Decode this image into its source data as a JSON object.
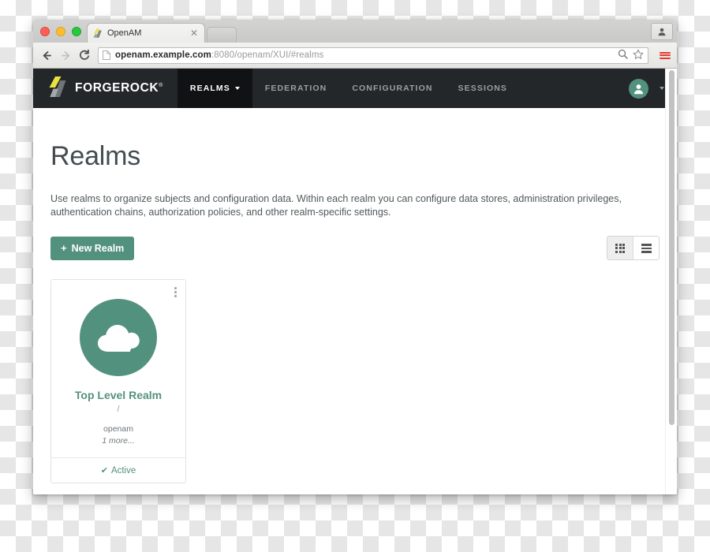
{
  "browser": {
    "tab": {
      "title": "OpenAM",
      "favicon_icon": "forgerock-favicon",
      "close_icon": "close-icon"
    },
    "new_tab_icon": "new-tab-button",
    "traffic_lights": [
      "close-window",
      "minimize-window",
      "maximize-window"
    ],
    "back_icon": "back-arrow-icon",
    "forward_icon": "forward-arrow-icon",
    "reload_icon": "reload-icon",
    "page_icon": "page-document-icon",
    "url_host": "openam.example.com",
    "url_rest": ":8080/openam/XUI/#realms",
    "search_icon": "search-icon",
    "bookmark_icon": "star-icon",
    "menu_icon": "hamburger-menu-icon",
    "profile_icon": "person-icon"
  },
  "appnav": {
    "brand": "FORGEROCK",
    "brand_trademark": "®",
    "brand_logo_icon": "forgerock-logo-icon",
    "items": [
      {
        "label": "REALMS",
        "active": true,
        "has_caret": true
      },
      {
        "label": "FEDERATION",
        "active": false,
        "has_caret": false
      },
      {
        "label": "CONFIGURATION",
        "active": false,
        "has_caret": false
      },
      {
        "label": "SESSIONS",
        "active": false,
        "has_caret": false
      }
    ],
    "avatar_icon": "user-avatar-icon",
    "avatar_caret_icon": "chevron-down-icon"
  },
  "page": {
    "title": "Realms",
    "description": "Use realms to organize subjects and configuration data. Within each realm you can configure data stores, administration privileges, authentication chains, authorization policies, and other realm-specific settings.",
    "new_realm_label": "New Realm",
    "new_realm_plus": "+",
    "view_grid_icon": "grid-view-icon",
    "view_list_icon": "list-view-icon",
    "view_selected": "grid"
  },
  "realms": [
    {
      "name": "Top Level Realm",
      "path": "/",
      "alias": "openam",
      "more": "1 more...",
      "status": "Active",
      "status_check": "✔",
      "avatar_icon": "cloud-icon",
      "menu_icon": "kebab-menu-icon"
    }
  ],
  "colors": {
    "accent_teal": "#53917f",
    "nav_dark": "#23272a",
    "nav_active_dark": "#101214",
    "logo_yellow": "#e9e23f",
    "logo_gray": "#8c9296"
  }
}
